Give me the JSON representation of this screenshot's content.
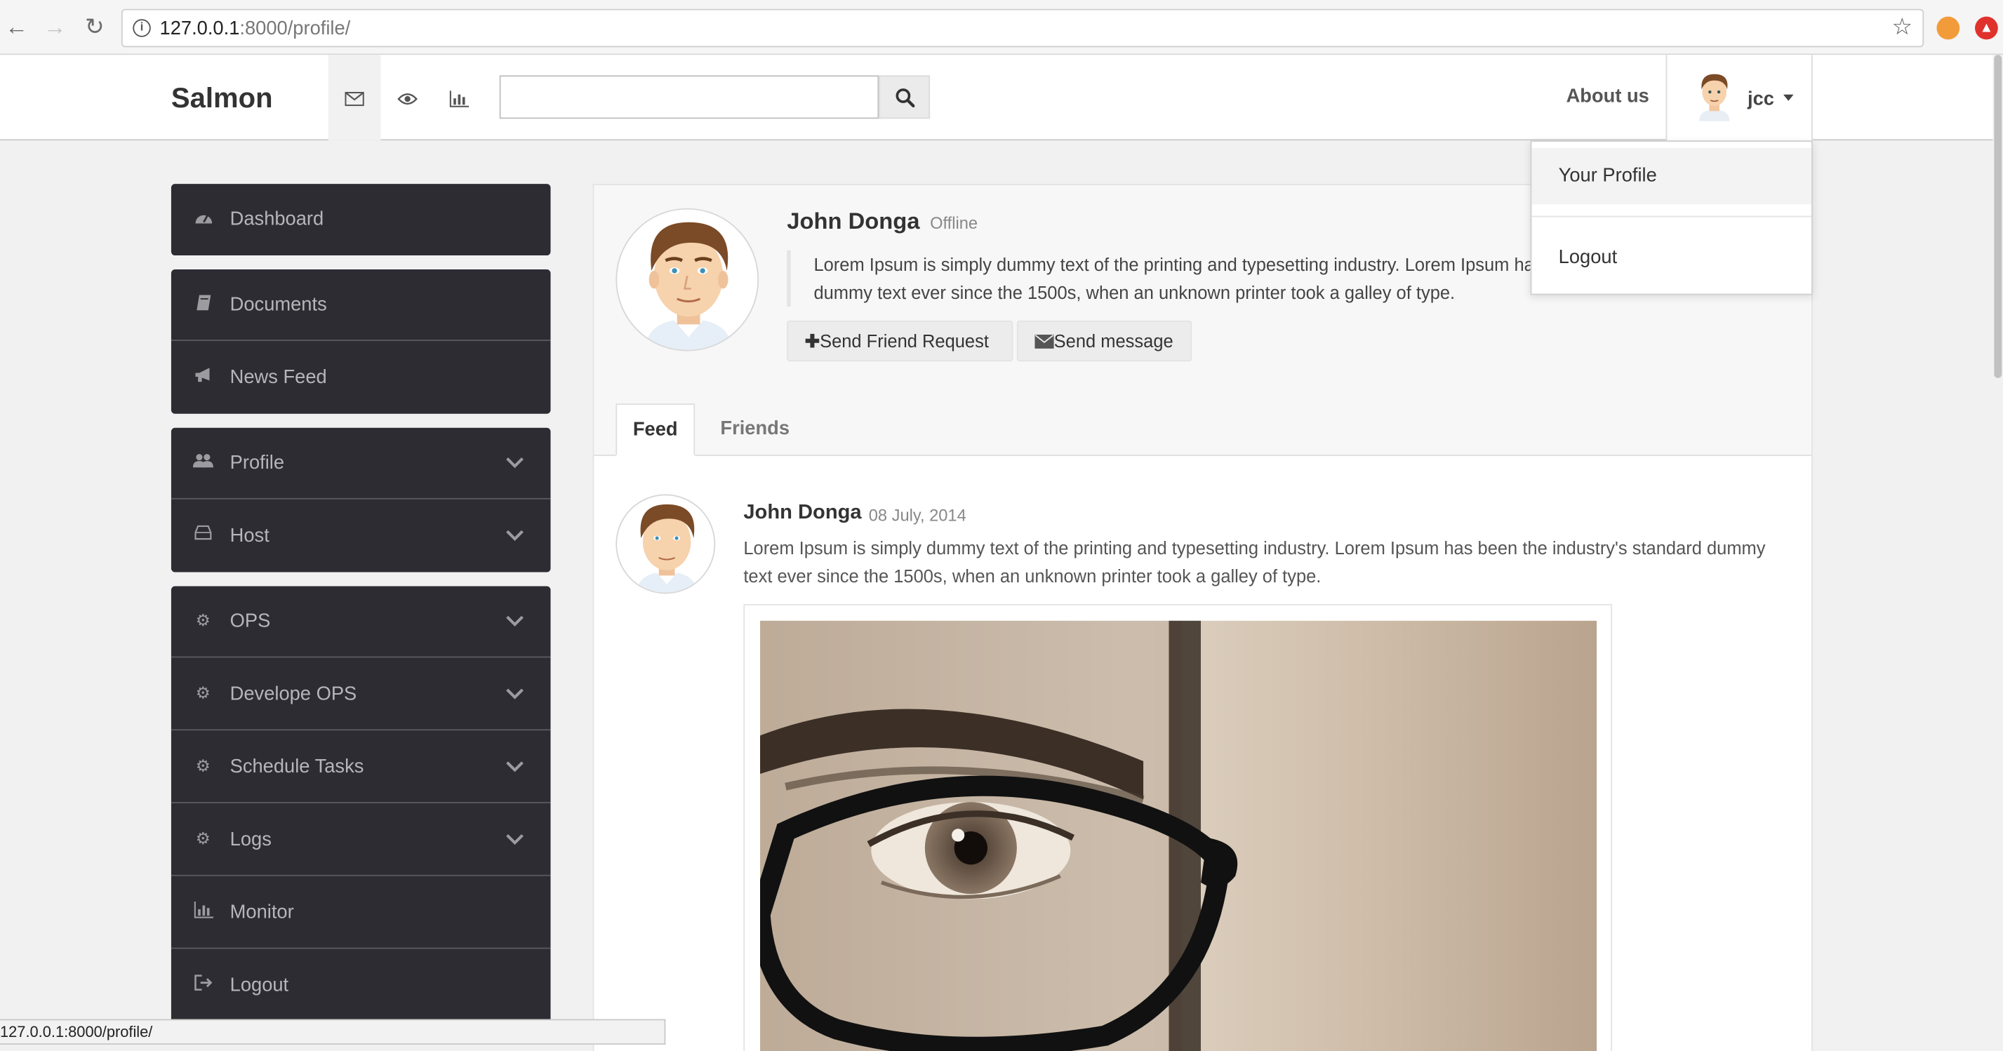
{
  "browser": {
    "url_host": "127.0.0.1",
    "url_port_path": ":8000/profile/",
    "status_url": "127.0.0.1:8000/profile/"
  },
  "navbar": {
    "brand": "Salmon",
    "search_placeholder": "",
    "about": "About us",
    "username": "jcc"
  },
  "dropdown": {
    "items": [
      "Your Profile",
      "Logout"
    ]
  },
  "sidebar": {
    "items": [
      {
        "label": "Dashboard",
        "icon": "dashboard-icon",
        "chevron": false
      },
      {
        "label": "Documents",
        "icon": "book-icon",
        "chevron": false
      },
      {
        "label": "News Feed",
        "icon": "bullhorn-icon",
        "chevron": false
      },
      {
        "label": "Profile",
        "icon": "users-icon",
        "chevron": true
      },
      {
        "label": "Host",
        "icon": "hdd-icon",
        "chevron": true
      },
      {
        "label": "OPS",
        "icon": "gear-icon",
        "chevron": true
      },
      {
        "label": "Develope OPS",
        "icon": "gear-icon",
        "chevron": true
      },
      {
        "label": "Schedule Tasks",
        "icon": "gear-icon",
        "chevron": true
      },
      {
        "label": "Logs",
        "icon": "gear-icon",
        "chevron": true
      },
      {
        "label": "Monitor",
        "icon": "bar-chart-icon",
        "chevron": false
      },
      {
        "label": "Logout",
        "icon": "sign-out-icon",
        "chevron": false
      }
    ]
  },
  "profile": {
    "name": "John Donga",
    "status": "Offline",
    "bio": "Lorem Ipsum is simply dummy text of the printing and typesetting industry. Lorem Ipsum has been the industry's standard dummy text ever since the 1500s, when an unknown printer took a galley of type.",
    "friend_button": "Send Friend Request",
    "message_button": "Send message"
  },
  "tabs": [
    "Feed",
    "Friends"
  ],
  "post": {
    "author": "John Donga",
    "date": "08 July, 2014",
    "text": "Lorem Ipsum is simply dummy text of the printing and typesetting industry. Lorem Ipsum has been the industry's standard dummy text ever since the 1500s, when an unknown printer took a galley of type."
  },
  "colors": {
    "sidebar_bg": "#2d2c33",
    "sidebar_text": "#b6b6ba",
    "page_bg": "#f1f1f1"
  }
}
